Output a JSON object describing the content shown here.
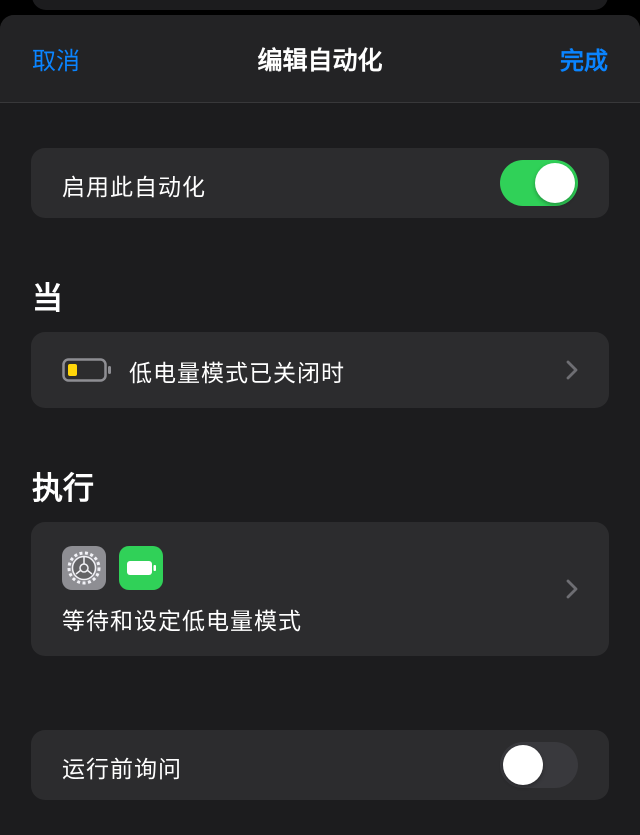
{
  "nav": {
    "cancel_label": "取消",
    "title": "编辑自动化",
    "done_label": "完成"
  },
  "enable_row": {
    "label": "启用此自动化",
    "toggle_on": true
  },
  "when_section": {
    "header": "当",
    "trigger_label": "低电量模式已关闭时",
    "trigger_icon": "battery-low-icon"
  },
  "do_section": {
    "header": "执行",
    "action_icons": [
      "settings-gear-icon",
      "battery-icon"
    ],
    "action_label": "等待和设定低电量模式"
  },
  "ask_row": {
    "label": "运行前询问",
    "toggle_on": false
  },
  "colors": {
    "accent": "#0a84ff",
    "toggle_on": "#30d158",
    "toggle_off": "#39393d",
    "battery_warning": "#ffd60a",
    "card_bg": "#2c2c2e"
  }
}
